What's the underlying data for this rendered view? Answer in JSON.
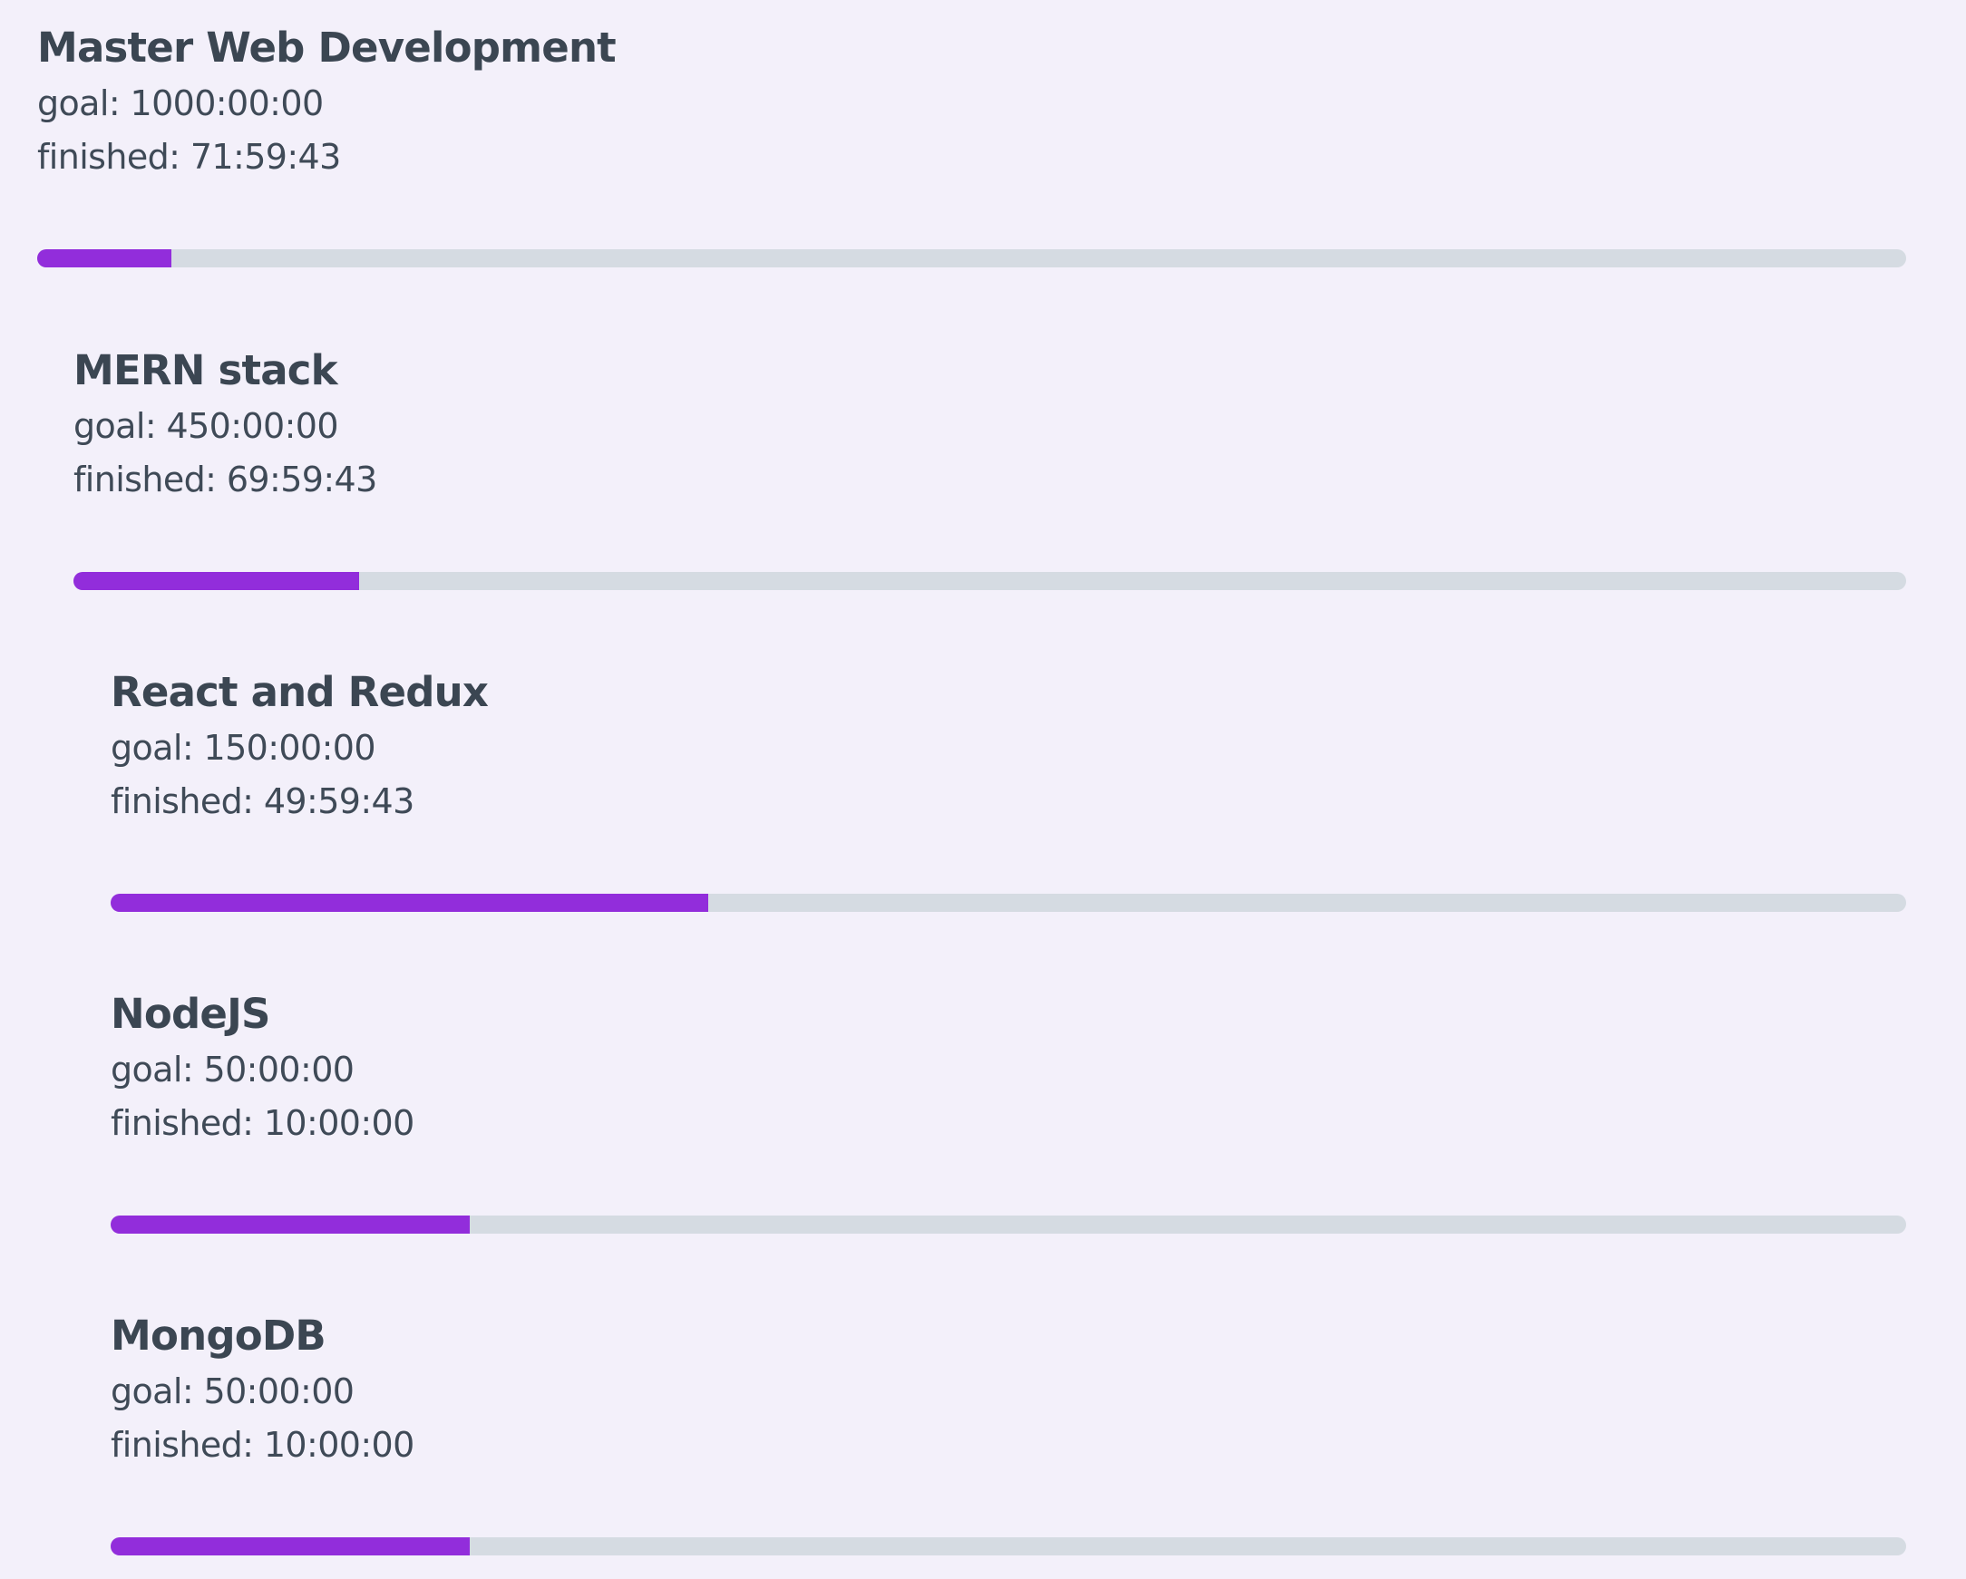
{
  "colors": {
    "background": "#f3f0fa",
    "text": "#3b4754",
    "progress_fill": "#922ddb",
    "progress_track": "#d5dbe2"
  },
  "goals": [
    {
      "title": "Master Web Development",
      "goal_text": "goal: 1000:00:00",
      "finished_text": "finished: 71:59:43",
      "progress": 0.072
    },
    {
      "title": "MERN stack",
      "goal_text": "goal: 450:00:00",
      "finished_text": "finished: 69:59:43",
      "progress": 0.156
    },
    {
      "title": "React and Redux",
      "goal_text": "goal: 150:00:00",
      "finished_text": "finished: 49:59:43",
      "progress": 0.333
    },
    {
      "title": "NodeJS",
      "goal_text": "goal: 50:00:00",
      "finished_text": "finished: 10:00:00",
      "progress": 0.2
    },
    {
      "title": "MongoDB",
      "goal_text": "goal: 50:00:00",
      "finished_text": "finished: 10:00:00",
      "progress": 0.2
    }
  ]
}
